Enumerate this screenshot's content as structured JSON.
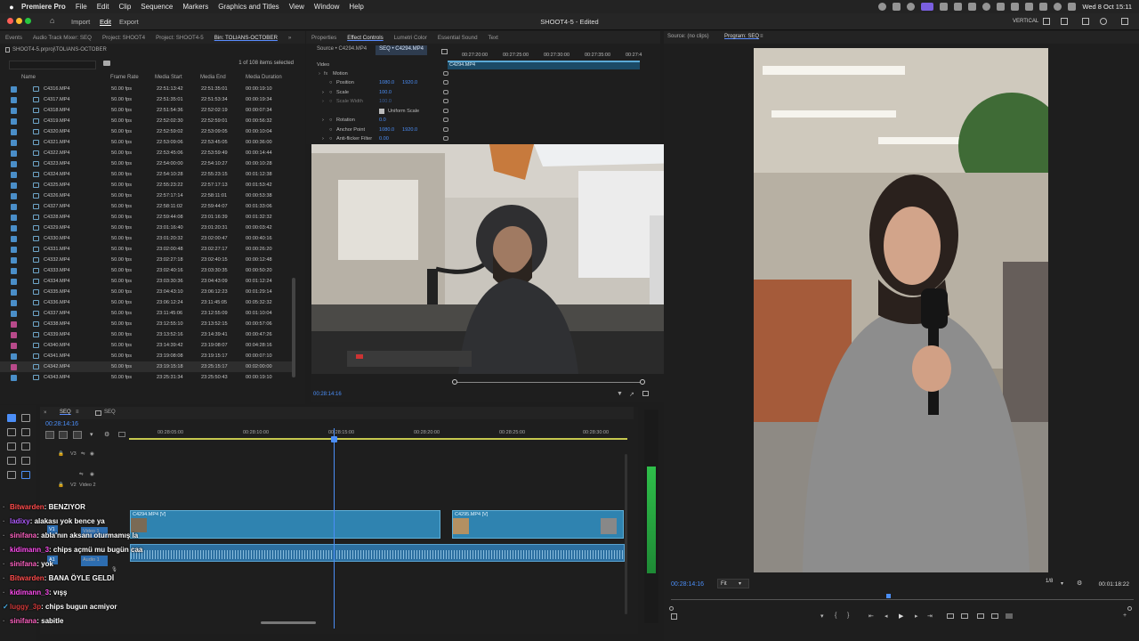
{
  "menubar": {
    "app": "Premiere Pro",
    "items": [
      "File",
      "Edit",
      "Clip",
      "Sequence",
      "Markers",
      "Graphics and Titles",
      "View",
      "Window",
      "Help"
    ],
    "datetime": "Wed 8 Oct  15:11"
  },
  "appbar": {
    "nav": [
      "Import",
      "Edit",
      "Export"
    ],
    "active": "Edit",
    "document_title": "SHOOT4-5 - Edited",
    "workspace": "VERTICAL"
  },
  "project_panel": {
    "tabs": [
      "Events",
      "Audio Track Mixer: SEQ",
      "Project: SHOOT4",
      "Project: SHOOT4-5",
      "Bin: TOLIANS-OCTOBER"
    ],
    "active_tab": "Bin: TOLIANS-OCTOBER",
    "path": "SHOOT4-5.prproj\\TOLIANS-OCTOBER",
    "selection_count": "1 of 108 items selected",
    "columns": [
      "Name",
      "Frame Rate",
      "Media Start",
      "Media End",
      "Media Duration"
    ],
    "rows": [
      [
        "C4316.MP4",
        "50.00 fps",
        "22:51:13:42",
        "22:51:35:01",
        "00:00:19:10"
      ],
      [
        "C4317.MP4",
        "50.00 fps",
        "22:51:35:01",
        "22:51:53:34",
        "00:00:19:34"
      ],
      [
        "C4318.MP4",
        "50.00 fps",
        "22:51:54:36",
        "22:52:02:19",
        "00:00:07:34"
      ],
      [
        "C4319.MP4",
        "50.00 fps",
        "22:52:02:30",
        "22:52:59:01",
        "00:00:56:32"
      ],
      [
        "C4320.MP4",
        "50.00 fps",
        "22:52:59:02",
        "22:53:09:05",
        "00:00:10:04"
      ],
      [
        "C4321.MP4",
        "50.00 fps",
        "22:53:09:06",
        "22:53:45:05",
        "00:00:36:00"
      ],
      [
        "C4322.MP4",
        "50.00 fps",
        "22:53:45:06",
        "22:53:59:49",
        "00:00:14:44"
      ],
      [
        "C4323.MP4",
        "50.00 fps",
        "22:54:00:00",
        "22:54:10:27",
        "00:00:10:28"
      ],
      [
        "C4324.MP4",
        "50.00 fps",
        "22:54:10:28",
        "22:55:23:15",
        "00:01:12:38"
      ],
      [
        "C4325.MP4",
        "50.00 fps",
        "22:55:23:22",
        "22:57:17:13",
        "00:01:53:42"
      ],
      [
        "C4326.MP4",
        "50.00 fps",
        "22:57:17:14",
        "22:58:11:01",
        "00:00:53:38"
      ],
      [
        "C4327.MP4",
        "50.00 fps",
        "22:58:11:02",
        "22:59:44:07",
        "00:01:33:06"
      ],
      [
        "C4328.MP4",
        "50.00 fps",
        "22:59:44:08",
        "23:01:16:39",
        "00:01:32:32"
      ],
      [
        "C4329.MP4",
        "50.00 fps",
        "23:01:16:40",
        "23:01:20:31",
        "00:00:03:42"
      ],
      [
        "C4330.MP4",
        "50.00 fps",
        "23:01:20:32",
        "23:02:00:47",
        "00:00:40:16"
      ],
      [
        "C4331.MP4",
        "50.00 fps",
        "23:02:00:48",
        "23:02:27:17",
        "00:00:26:20"
      ],
      [
        "C4332.MP4",
        "50.00 fps",
        "23:02:27:18",
        "23:02:40:15",
        "00:00:12:48"
      ],
      [
        "C4333.MP4",
        "50.00 fps",
        "23:02:40:16",
        "23:03:30:35",
        "00:00:50:20"
      ],
      [
        "C4334.MP4",
        "50.00 fps",
        "23:03:30:36",
        "23:04:43:09",
        "00:01:12:24"
      ],
      [
        "C4335.MP4",
        "50.00 fps",
        "23:04:43:10",
        "23:06:12:23",
        "00:01:29:14"
      ],
      [
        "C4336.MP4",
        "50.00 fps",
        "23:06:12:24",
        "23:11:45:05",
        "00:05:32:32"
      ],
      [
        "C4337.MP4",
        "50.00 fps",
        "23:11:45:06",
        "23:12:55:09",
        "00:01:10:04"
      ],
      [
        "C4338.MP4",
        "50.00 fps",
        "23:12:55:10",
        "23:13:52:15",
        "00:00:57:06"
      ],
      [
        "C4339.MP4",
        "50.00 fps",
        "23:13:52:16",
        "23:14:39:41",
        "00:00:47:26"
      ],
      [
        "C4340.MP4",
        "50.00 fps",
        "23:14:39:42",
        "23:19:08:07",
        "00:04:28:16"
      ],
      [
        "C4341.MP4",
        "50.00 fps",
        "23:19:08:08",
        "23:19:15:17",
        "00:00:07:10"
      ],
      [
        "C4342.MP4",
        "50.00 fps",
        "23:19:15:18",
        "23:25:15:17",
        "00:02:00:00"
      ],
      [
        "C4343.MP4",
        "50.00 fps",
        "23:25:31:34",
        "23:25:50:43",
        "00:00:19:10"
      ]
    ]
  },
  "effect_controls": {
    "tabs": [
      "Properties",
      "Effect Controls",
      "Lumetri Color",
      "Essential Sound",
      "Text"
    ],
    "active_tab": "Effect Controls",
    "source": "Source • C4294.MP4",
    "sequence": "SEQ • C4294.MP4",
    "section": "Video",
    "fx": "Motion",
    "properties": [
      {
        "name": "Position",
        "v1": "1080.0",
        "v2": "1920.0"
      },
      {
        "name": "Scale",
        "v1": "100.0",
        "v2": ""
      },
      {
        "name": "Scale Width",
        "v1": "100.0",
        "v2": ""
      },
      {
        "name": "Uniform Scale",
        "v1": "",
        "v2": ""
      },
      {
        "name": "Rotation",
        "v1": "0.0",
        "v2": ""
      },
      {
        "name": "Anchor Point",
        "v1": "1080.0",
        "v2": "1920.0"
      },
      {
        "name": "Anti-flicker Filter",
        "v1": "0.00",
        "v2": ""
      }
    ],
    "ruler": [
      "00:27:20:00",
      "00:27:25:00",
      "00:27:30:00",
      "00:27:35:00",
      "00:27:4"
    ],
    "clip": "C4294.MP4"
  },
  "source_monitor": {
    "timecode": "00:28:14:16"
  },
  "timeline": {
    "tab": "SEQ",
    "timecode": "00:28:14:16",
    "ruler": [
      "00:28:05:00",
      "00:28:10:00",
      "00:28:15:00",
      "00:28:20:00",
      "00:28:25:00",
      "00:28:30:00"
    ],
    "tracks": {
      "v3": "V3",
      "v2": "V2",
      "v2_name": "Video 2",
      "v1": "V1",
      "v1_name": "Video 1",
      "a1": "A1",
      "a1_name": "Audio 1"
    },
    "clips": [
      "C4294.MP4 [V]",
      "C4295.MP4 [V]"
    ]
  },
  "program_monitor": {
    "source_tab": "Source: (no clips)",
    "program_tab": "Program: SEQ",
    "timecode": "00:28:14:16",
    "fit": "Fit",
    "resolution": "1/8",
    "duration": "00:01:18:22"
  },
  "chat": [
    {
      "user": "Bitwarden",
      "text": "BENZIYOR",
      "color": "#ff4d4d",
      "mark": ""
    },
    {
      "user": "ladixy",
      "text": "alakası yok bence ya",
      "color": "#b05cff",
      "mark": ""
    },
    {
      "user": "sinifana",
      "text": "abla'nın aksanı oturmamış la",
      "color": "#ff62c2",
      "mark": ""
    },
    {
      "user": "kidimann_3",
      "text": "chips açmü mu bugün caa",
      "color": "#ff4df0",
      "mark": ""
    },
    {
      "user": "sinifana",
      "text": "yok",
      "color": "#ff62c2",
      "mark": ""
    },
    {
      "user": "Bitwarden",
      "text": "BANA ÖYLE GELDİ",
      "color": "#ff4d4d",
      "mark": ""
    },
    {
      "user": "kidimann_3",
      "text": "vışş",
      "color": "#ff4df0",
      "mark": ""
    },
    {
      "user": "luggy_3p",
      "text": "chips bugun acmiyor",
      "color": "#d23b3b",
      "mark": "✓"
    },
    {
      "user": "sinifana",
      "text": "sabitle",
      "color": "#ff62c2",
      "mark": ""
    }
  ]
}
